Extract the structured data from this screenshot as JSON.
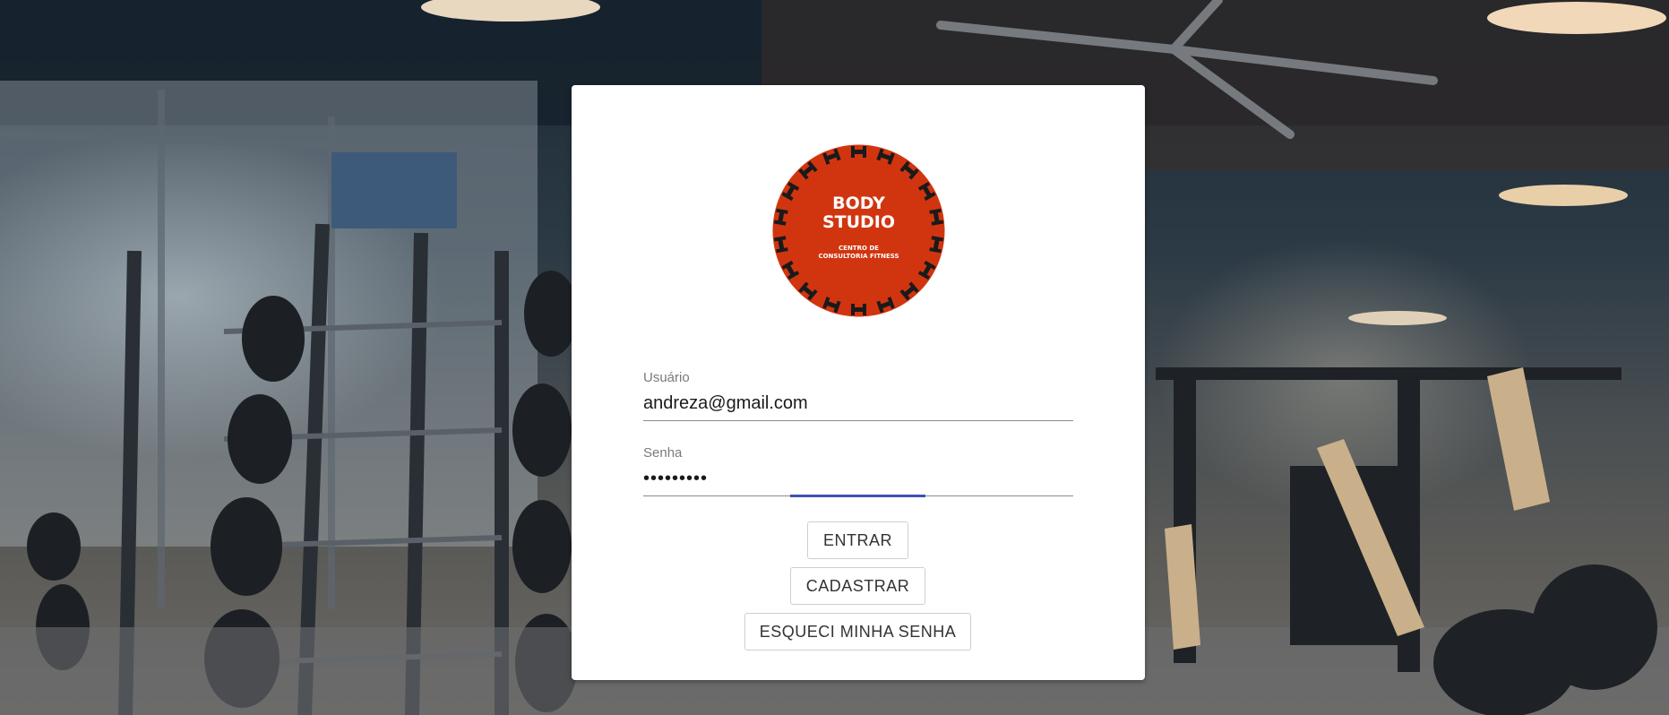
{
  "brand": {
    "logo_line1": "BODY",
    "logo_line2": "STUDIO",
    "logo_sub1": "CENTRO DE",
    "logo_sub2": "CONSULTORIA FITNESS",
    "logo_color": "#d1350f"
  },
  "form": {
    "user_label": "Usuário",
    "user_value": "andreza@gmail.com",
    "password_label": "Senha",
    "password_value": "•••••••••",
    "focus_color": "#3f51b5"
  },
  "buttons": {
    "login": "ENTRAR",
    "register": "CADASTRAR",
    "forgot": "ESQUECI MINHA SENHA"
  }
}
